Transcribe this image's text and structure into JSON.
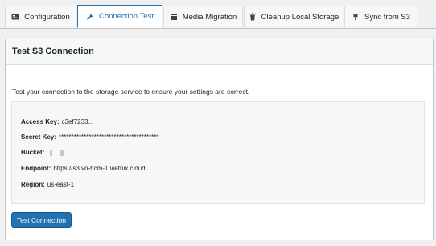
{
  "tabs": [
    {
      "label": "Configuration",
      "icon": "gear-icon"
    },
    {
      "label": "Connection Test",
      "icon": "wrench-icon"
    },
    {
      "label": "Media Migration",
      "icon": "database-icon"
    },
    {
      "label": "Cleanup Local Storage",
      "icon": "trash-icon"
    },
    {
      "label": "Sync from S3",
      "icon": "sync-icon"
    }
  ],
  "active_tab": "Connection Test",
  "card": {
    "title": "Test S3 Connection",
    "description": "Test your connection to the storage service to ensure your settings are correct."
  },
  "details": {
    "access_key": {
      "label": "Access Key:",
      "value": "c3ef7233..."
    },
    "secret_key": {
      "label": "Secret Key:",
      "value": "****************************************"
    },
    "bucket": {
      "label": "Bucket:",
      "value": ""
    },
    "endpoint": {
      "label": "Endpoint:",
      "value": "https://s3.vn-hcm-1.vietnix.cloud"
    },
    "region": {
      "label": "Region:",
      "value": "us-east-1"
    }
  },
  "button": {
    "label": "Test Connection"
  },
  "colors": {
    "accent": "#2271b1",
    "panel": "#f6f7f7",
    "background": "#f0f0f1"
  }
}
